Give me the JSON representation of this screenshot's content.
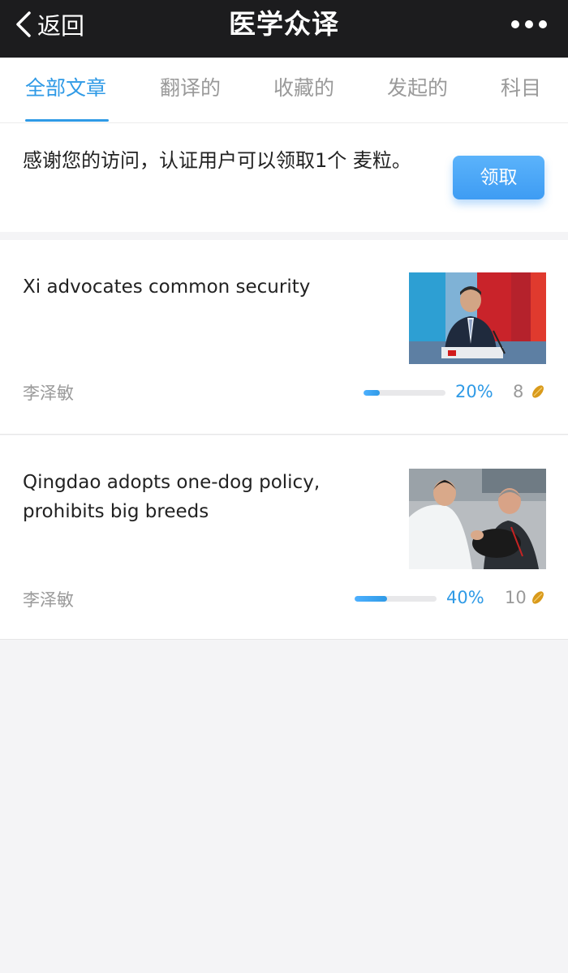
{
  "navbar": {
    "back_label": "返回",
    "title": "医学众译"
  },
  "tabs": [
    {
      "label": "全部文章",
      "active": true
    },
    {
      "label": "翻译的",
      "active": false
    },
    {
      "label": "收藏的",
      "active": false
    },
    {
      "label": "发起的",
      "active": false
    },
    {
      "label": "科目",
      "active": false
    }
  ],
  "notice": {
    "text": "感谢您的访问，认证用户可以领取1个 麦粒。",
    "button_label": "领取"
  },
  "articles": [
    {
      "title": "Xi advocates common security",
      "author": "李泽敏",
      "progress": 0.2,
      "progress_label": "20%",
      "count": "8"
    },
    {
      "title": "Qingdao adopts one-dog policy, prohibits big breeds",
      "author": "李泽敏",
      "progress": 0.4,
      "progress_label": "40%",
      "count": "10"
    }
  ],
  "colors": {
    "accent": "#2f9ae6",
    "navbar_bg": "#1c1c1e",
    "page_bg": "#f4f4f6"
  }
}
